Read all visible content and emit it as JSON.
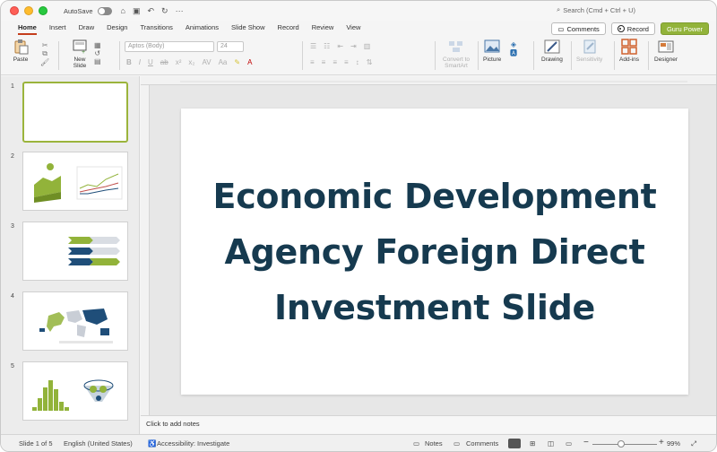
{
  "titlebar": {
    "autosave_label": "AutoSave",
    "search_placeholder": "Search (Cmd + Ctrl + U)"
  },
  "tabs": [
    "Home",
    "Insert",
    "Draw",
    "Design",
    "Transitions",
    "Animations",
    "Slide Show",
    "Record",
    "Review",
    "View"
  ],
  "header_buttons": {
    "comments": "Comments",
    "record": "Record",
    "guru": "Guru Power"
  },
  "ribbon": {
    "paste": "Paste",
    "new_slide": "New Slide",
    "font_name": "Aptos (Body)",
    "font_size": "24",
    "convert": "Convert to SmartArt",
    "picture": "Picture",
    "drawing": "Drawing",
    "sensitivity": "Sensitivity",
    "addins": "Add-ins",
    "designer": "Designer"
  },
  "thumbnails": [
    "1",
    "2",
    "3",
    "4",
    "5"
  ],
  "slide": {
    "title": "Economic Development Agency Foreign Direct Investment Slide"
  },
  "notes_placeholder": "Click to add notes",
  "status": {
    "slide_count": "Slide 1 of 5",
    "language": "English (United States)",
    "accessibility": "Accessibility: Investigate",
    "notes": "Notes",
    "comments": "Comments",
    "zoom": "99%"
  },
  "colors": {
    "accent_tab": "#c43e1c",
    "selection": "#9bb43c",
    "title_text": "#163a4f",
    "guru_button": "#92b33a"
  }
}
